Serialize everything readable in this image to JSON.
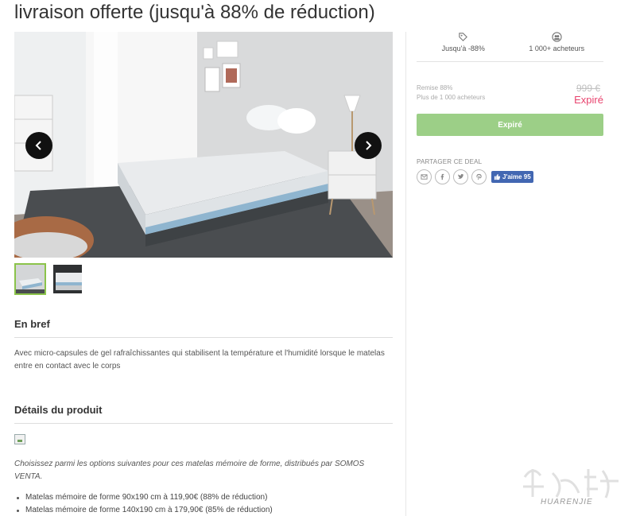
{
  "page": {
    "title": "livraison offerte (jusqu'à 88% de réduction)"
  },
  "gallery": {
    "prev_icon": "chevron-left-icon",
    "next_icon": "chevron-right-icon",
    "active_thumb": 1
  },
  "sections": {
    "bref": {
      "heading": "En bref",
      "text": "Avec micro-capsules de gel rafraîchissantes qui stabilisent la température et l'humidité lorsque le matelas entre en contact avec le corps"
    },
    "details": {
      "heading": "Détails du produit",
      "intro": "Choisissez parmi les options suivantes pour ces matelas mémoire de forme, distribués par SOMOS VENTA.",
      "items": [
        "Matelas mémoire de forme 90x190 cm à 119,90€ (88% de réduction)",
        "Matelas mémoire de forme 140x190 cm à 179,90€ (85% de réduction)"
      ]
    }
  },
  "panel": {
    "stats": [
      {
        "icon": "tag-icon",
        "label": "Jusqu'à -88%"
      },
      {
        "icon": "buyers-icon",
        "label": "1 000+ acheteurs"
      }
    ],
    "remise": "Remise 88%",
    "buyers_small": "Plus de 1 000 acheteurs",
    "old_price": "999 €",
    "status": "Expiré",
    "cta_label": "Expiré",
    "share_heading": "PARTAGER CE DEAL",
    "share_icons": [
      "mail-icon",
      "facebook-icon",
      "twitter-icon",
      "pinterest-icon"
    ],
    "fb_like_label": "J'aime 95"
  },
  "watermark": {
    "text": "HUARENJIE"
  },
  "colors": {
    "accent_green": "#9ccf87",
    "thumb_border": "#8bc34a",
    "expired_pink": "#e8436e",
    "fb_blue": "#4267b2"
  }
}
